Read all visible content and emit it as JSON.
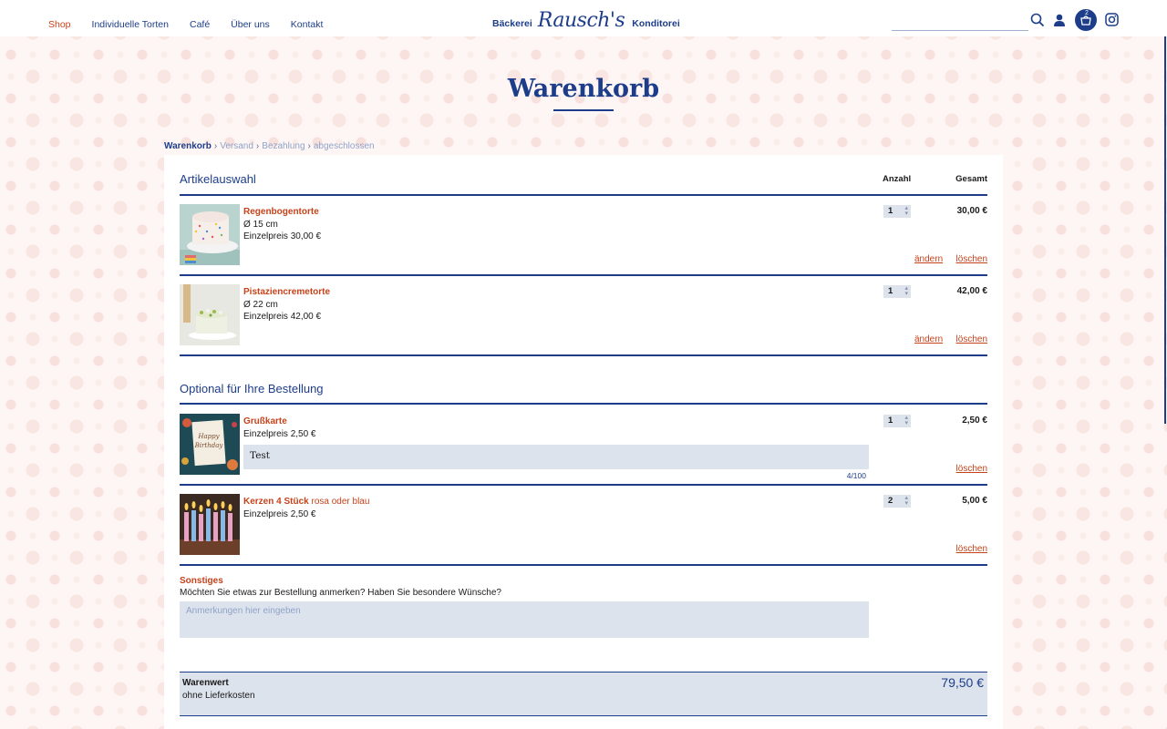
{
  "nav": {
    "items": [
      {
        "label": "Shop",
        "active": true
      },
      {
        "label": "Individuelle Torten"
      },
      {
        "label": "Café"
      },
      {
        "label": "Über uns"
      },
      {
        "label": "Kontakt"
      }
    ]
  },
  "logo": {
    "left": "Bäckerei",
    "script": "Rausch's",
    "right": "Konditorei"
  },
  "header": {
    "cart_count": "2",
    "icons": [
      "search-icon",
      "user-icon",
      "cart-icon",
      "instagram-icon"
    ]
  },
  "page": {
    "title": "Warenkorb"
  },
  "breadcrumb": {
    "current": "Warenkorb",
    "steps": [
      "Versand",
      "Bezahlung",
      "abgeschlossen"
    ]
  },
  "cart": {
    "section_title": "Artikelauswahl",
    "col_qty": "Anzahl",
    "col_total": "Gesamt",
    "items": [
      {
        "name": "Regenbogentorte",
        "size": "Ø 15 cm",
        "unit_price": "Einzelpreis 30,00 €",
        "qty": "1",
        "total": "30,00 €",
        "edit": "ändern",
        "delete": "löschen"
      },
      {
        "name": "Pistaziencremetorte",
        "size": "Ø 22 cm",
        "unit_price": "Einzelpreis 42,00 €",
        "qty": "1",
        "total": "42,00 €",
        "edit": "ändern",
        "delete": "löschen"
      }
    ]
  },
  "optional": {
    "section_title": "Optional für Ihre Bestellung",
    "items": [
      {
        "name": "Grußkarte",
        "unit_price": "Einzelpreis 2,50 €",
        "qty": "1",
        "total": "2,50 €",
        "card_text": "Test",
        "counter": "4/100",
        "delete": "löschen"
      },
      {
        "name": "Kerzen 4 Stück",
        "variant": "rosa oder blau",
        "unit_price": "Einzelpreis 2,50 €",
        "qty": "2",
        "total": "5,00 €",
        "delete": "löschen"
      }
    ]
  },
  "notes": {
    "label": "Sonstiges",
    "question": "Möchten Sie etwas zur Bestellung anmerken? Haben Sie besondere Wünsche?",
    "placeholder": "Anmerkungen hier eingeben"
  },
  "summary": {
    "label": "Warenwert",
    "sub": "ohne Lieferkosten",
    "value": "79,50 €"
  },
  "colors": {
    "brand_blue": "#1d3d8a",
    "accent_red": "#c6421b",
    "field_bg": "#dde3ed"
  }
}
